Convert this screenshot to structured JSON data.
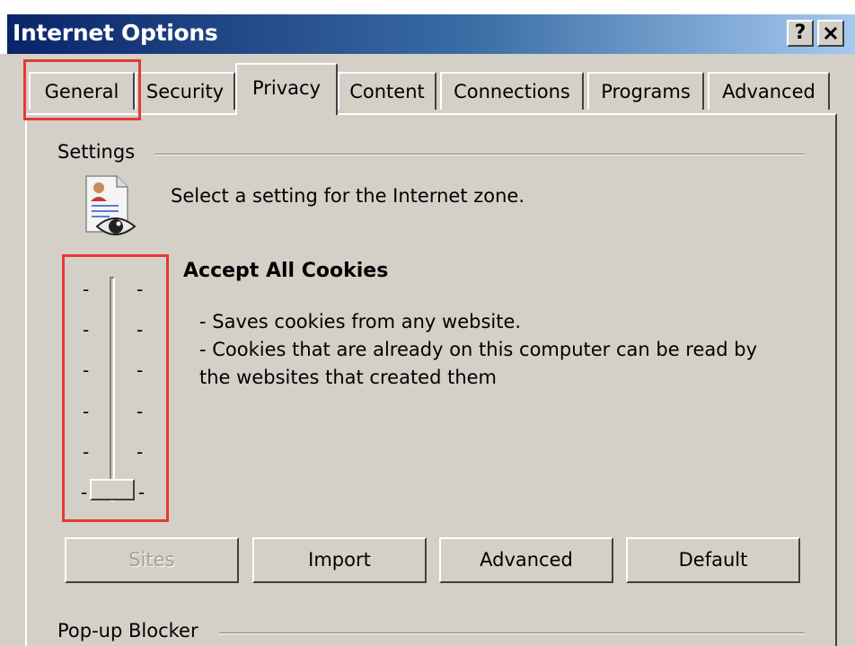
{
  "window": {
    "title": "Internet Options",
    "help_label": "?",
    "close_label": "✕"
  },
  "tabs": [
    {
      "label": "General"
    },
    {
      "label": "Security"
    },
    {
      "label": "Privacy"
    },
    {
      "label": "Content"
    },
    {
      "label": "Connections"
    },
    {
      "label": "Programs"
    },
    {
      "label": "Advanced"
    }
  ],
  "settings": {
    "group_label": "Settings",
    "zone_text": "Select a setting for the Internet zone.",
    "level_title": "Accept All Cookies",
    "line1": "- Saves cookies from any website.",
    "line2": "- Cookies that are already on this computer can be read by",
    "line3": "the websites that created them",
    "slider_level": "Accept All Cookies",
    "icon": "privacy-document-eye-icon"
  },
  "buttons": {
    "sites": "Sites",
    "import": "Import",
    "advanced": "Advanced",
    "default": "Default"
  },
  "popup": {
    "group_label": "Pop-up Blocker"
  },
  "colors": {
    "dialog_bg": "#d4d0c8",
    "title_gradient_start": "#0a246a",
    "highlight_red": "#e23a36"
  }
}
